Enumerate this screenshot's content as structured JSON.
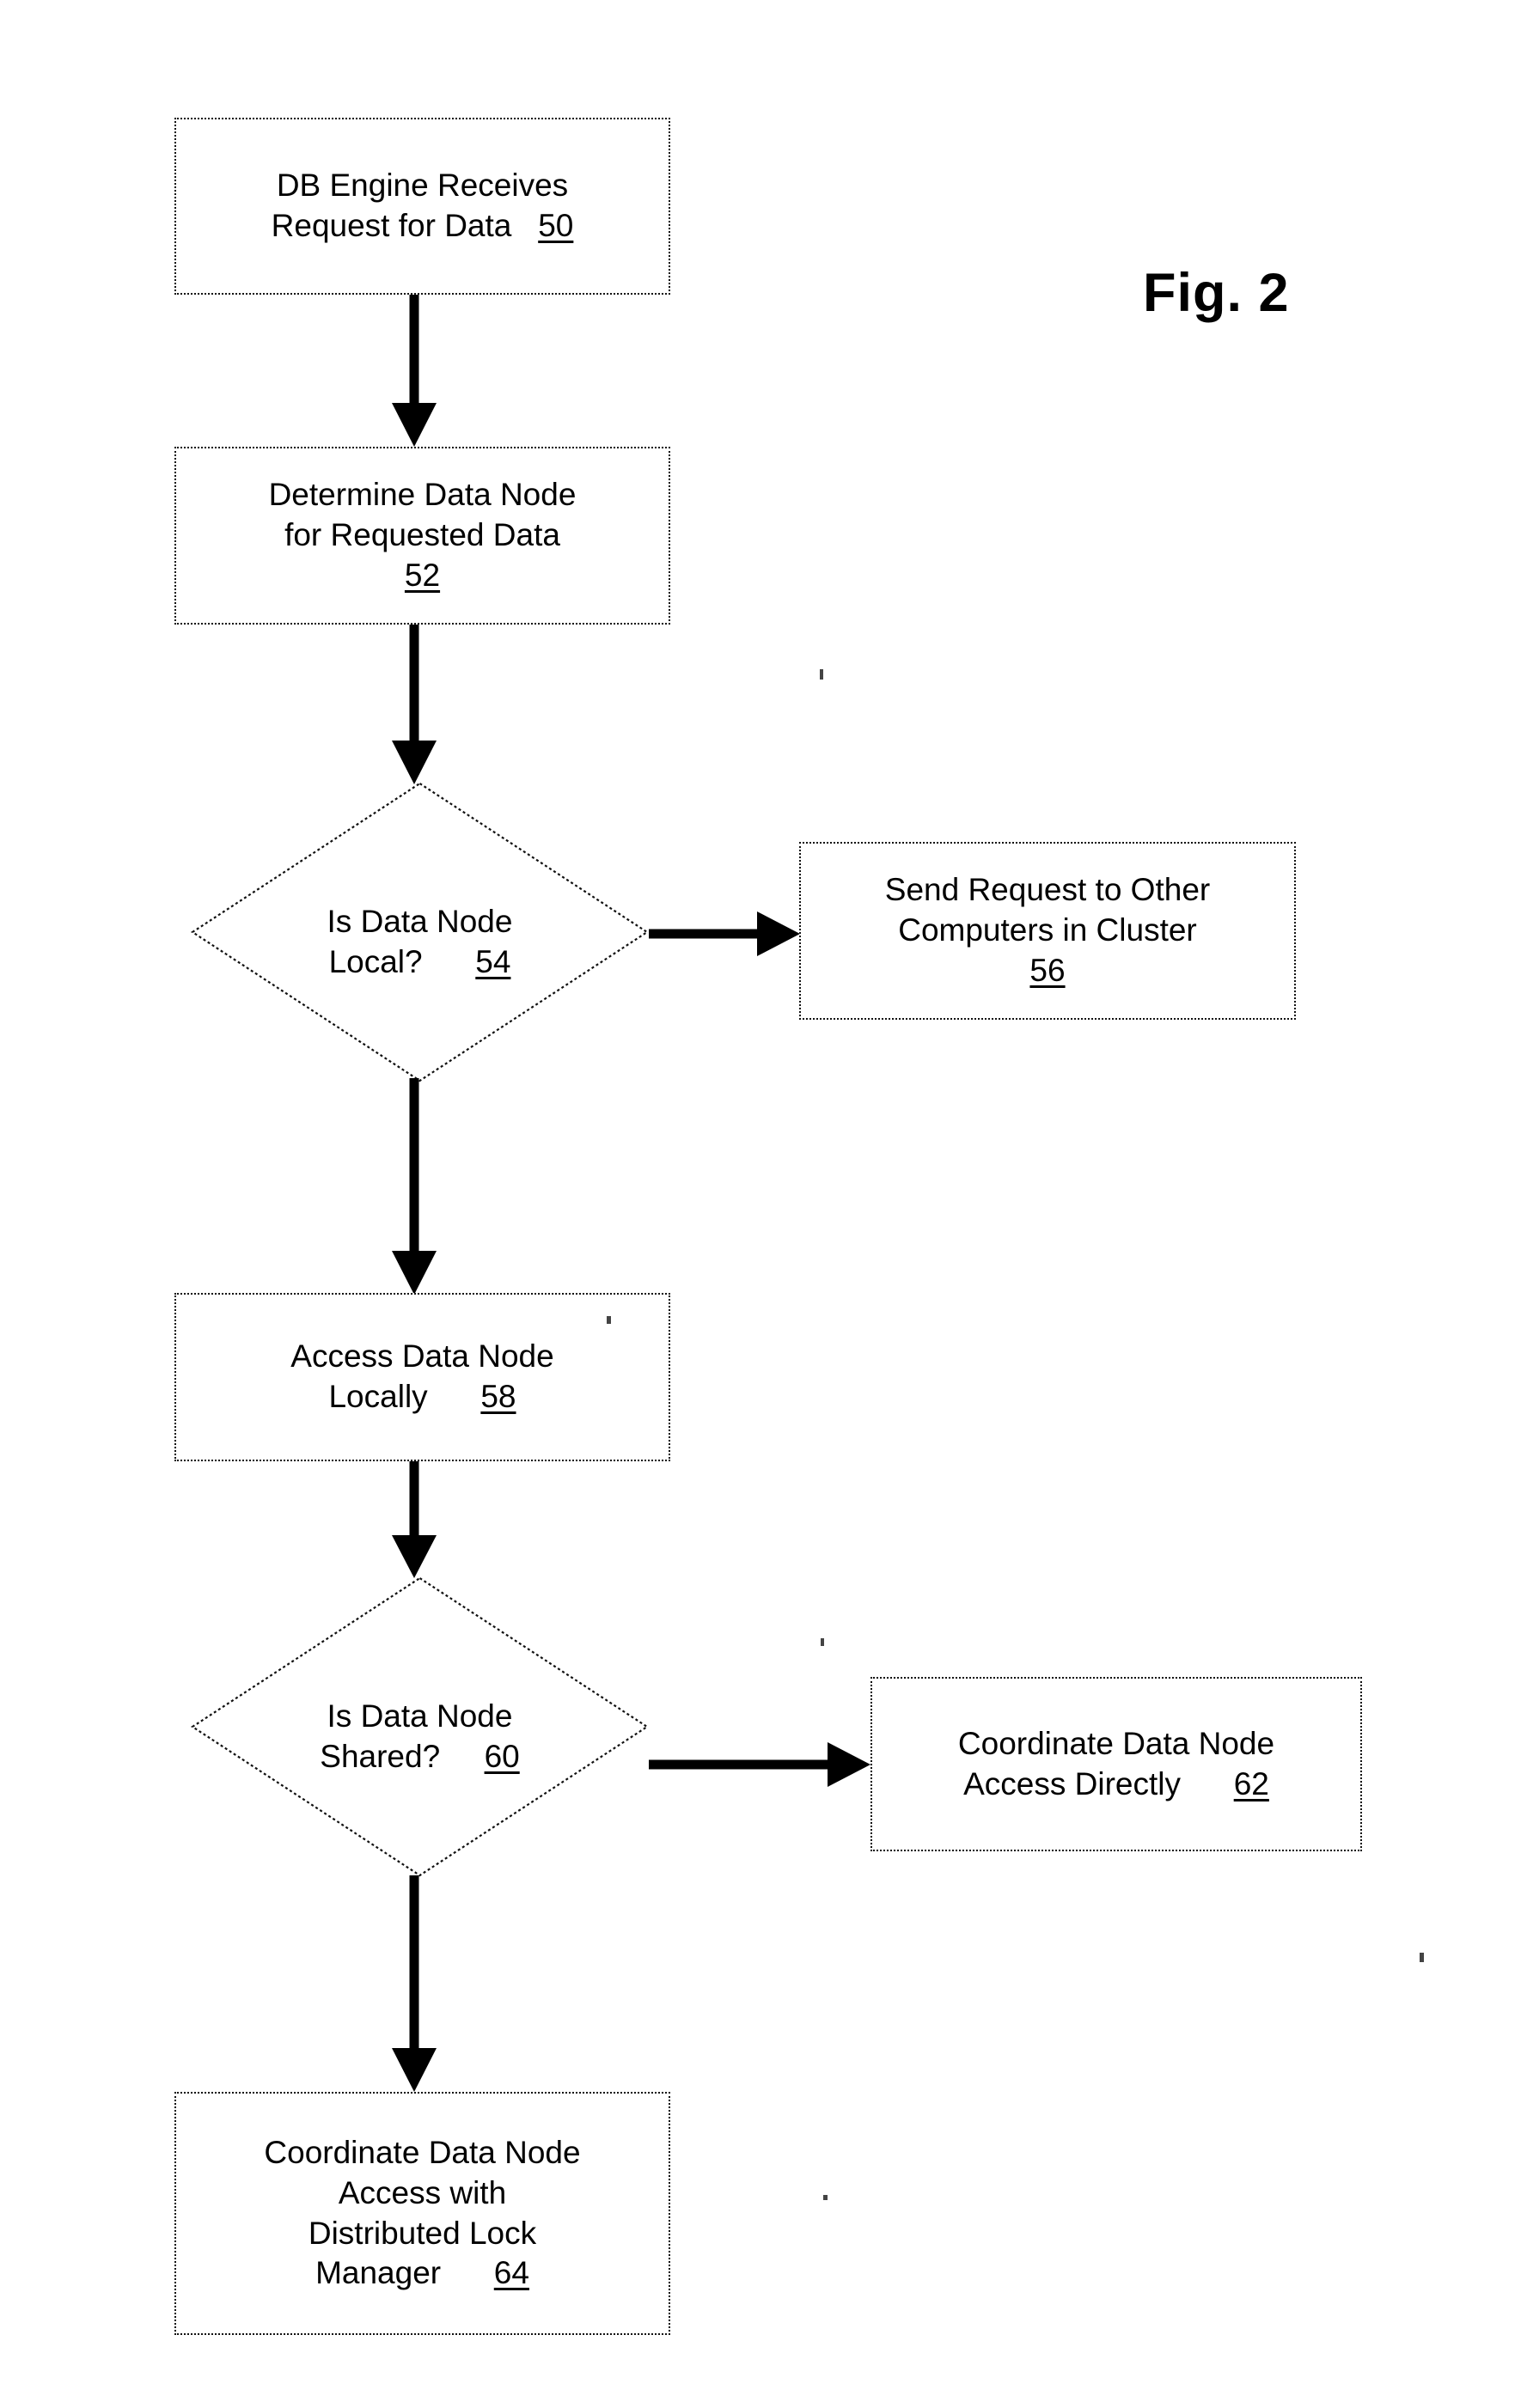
{
  "figure": {
    "label": "Fig. 2",
    "type": "patent-flowchart"
  },
  "nodes": [
    {
      "id": "50",
      "shape": "process",
      "lines": [
        "DB Engine Receives",
        "Request for Data"
      ],
      "ref": "50",
      "ref_on_last_line": true
    },
    {
      "id": "52",
      "shape": "process",
      "lines": [
        "Determine Data Node",
        "for Requested Data"
      ],
      "ref": "52",
      "ref_on_last_line": false
    },
    {
      "id": "54",
      "shape": "decision",
      "lines": [
        "Is Data Node",
        "Local?"
      ],
      "ref": "54",
      "ref_on_last_line": true
    },
    {
      "id": "56",
      "shape": "process",
      "lines": [
        "Send Request to Other",
        "Computers in Cluster"
      ],
      "ref": "56",
      "ref_on_last_line": false
    },
    {
      "id": "58",
      "shape": "process",
      "lines": [
        "Access Data Node",
        "Locally"
      ],
      "ref": "58",
      "ref_on_last_line": true
    },
    {
      "id": "60",
      "shape": "decision",
      "lines": [
        "Is Data Node",
        "Shared?"
      ],
      "ref": "60",
      "ref_on_last_line": true
    },
    {
      "id": "62",
      "shape": "process",
      "lines": [
        "Coordinate Data Node",
        "Access Directly"
      ],
      "ref": "62",
      "ref_on_last_line": true
    },
    {
      "id": "64",
      "shape": "process",
      "lines": [
        "Coordinate Data Node",
        "Access with",
        "Distributed Lock",
        "Manager"
      ],
      "ref": "64",
      "ref_on_last_line": true
    }
  ],
  "edges": [
    {
      "from": "50",
      "to": "52",
      "direction": "down"
    },
    {
      "from": "52",
      "to": "54",
      "direction": "down"
    },
    {
      "from": "54",
      "to": "56",
      "direction": "right"
    },
    {
      "from": "54",
      "to": "58",
      "direction": "down"
    },
    {
      "from": "58",
      "to": "60",
      "direction": "down"
    },
    {
      "from": "60",
      "to": "62",
      "direction": "right"
    },
    {
      "from": "60",
      "to": "64",
      "direction": "down"
    }
  ],
  "colors": {
    "ink": "#000000",
    "paper": "#ffffff"
  }
}
